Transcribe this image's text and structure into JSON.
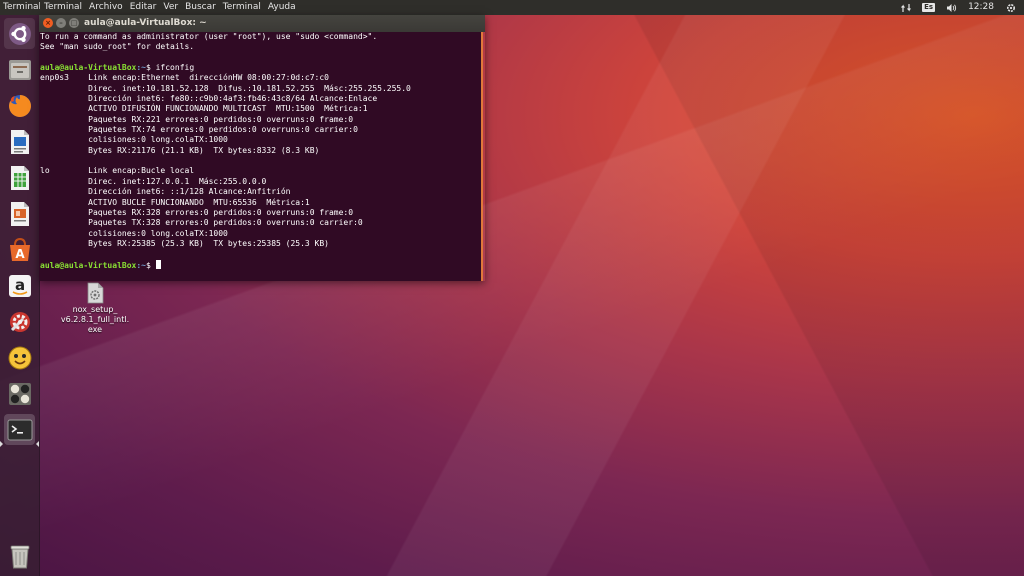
{
  "top_panel": {
    "app_title": "Terminal",
    "menu": [
      "Terminal",
      "Archivo",
      "Editar",
      "Ver",
      "Buscar",
      "Terminal",
      "Ayuda"
    ],
    "keyboard_layout": "Es",
    "clock": "12:28"
  },
  "launcher": {
    "items": [
      "ubuntu-dash-icon",
      "files-icon",
      "firefox-icon",
      "writer-icon",
      "calc-icon",
      "impress-icon",
      "software-center-icon",
      "amazon-icon",
      "system-settings-icon",
      "pidgin-icon",
      "mahjongg-icon",
      "terminal-icon",
      "trash-icon"
    ]
  },
  "terminal": {
    "title": "aula@aula-VirtualBox: ~",
    "prompt_user": "aula@aula-VirtualBox",
    "prompt_path": ":~",
    "prompt_symbol": "$ ",
    "command": "ifconfig",
    "output_pre": [
      "To run a command as administrator (user \"root\"), use \"sudo <command>\".",
      "See \"man sudo_root\" for details.",
      ""
    ],
    "output_post": [
      "enp0s3    Link encap:Ethernet  direcciónHW 08:00:27:0d:c7:c0",
      "          Direc. inet:10.181.52.128  Difus.:10.181.52.255  Másc:255.255.255.0",
      "          Dirección inet6: fe80::c9b0:4af3:fb46:43c8/64 Alcance:Enlace",
      "          ACTIVO DIFUSIÓN FUNCIONANDO MULTICAST  MTU:1500  Métrica:1",
      "          Paquetes RX:221 errores:0 perdidos:0 overruns:0 frame:0",
      "          Paquetes TX:74 errores:0 perdidos:0 overruns:0 carrier:0",
      "          colisiones:0 long.colaTX:1000",
      "          Bytes RX:21176 (21.1 KB)  TX bytes:8332 (8.3 KB)",
      "",
      "lo        Link encap:Bucle local",
      "          Direc. inet:127.0.0.1  Másc:255.0.0.0",
      "          Dirección inet6: ::1/128 Alcance:Anfitrión",
      "          ACTIVO BUCLE FUNCIONANDO  MTU:65536  Métrica:1",
      "          Paquetes RX:328 errores:0 perdidos:0 overruns:0 frame:0",
      "          Paquetes TX:328 errores:0 perdidos:0 overruns:0 carrier:0",
      "          colisiones:0 long.colaTX:1000",
      "          Bytes RX:25385 (25.3 KB)  TX bytes:25385 (25.3 KB)",
      ""
    ]
  },
  "desktop": {
    "file_label_lines": [
      "nox_setup_",
      "v6.2.8.1_full_intl.",
      "exe"
    ]
  }
}
